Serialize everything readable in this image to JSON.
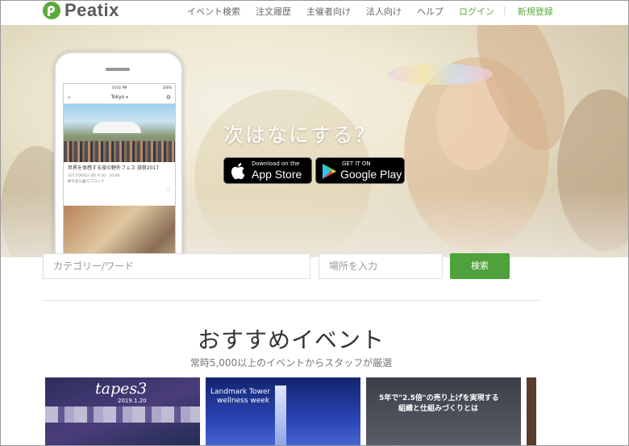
{
  "header": {
    "logo_text": "Peatix",
    "nav": [
      "イベント検索",
      "注文履歴",
      "主催者向け",
      "法人向け",
      "ヘルプ"
    ],
    "login": "ログイン",
    "signup": "新規登録"
  },
  "hero": {
    "title": "次はなにする？",
    "appstore": {
      "small": "Download on the",
      "big": "App Store"
    },
    "googleplay": {
      "small": "GET IT ON",
      "big": "Google Play"
    }
  },
  "phone": {
    "status_time": "10:02 PM",
    "status_battery": "100%",
    "location": "Tokyo",
    "event_title": "世界を体感する旅の野外フェス 旅祭2017",
    "event_date": "2017/09/03 (日) 9:30 - 20:00",
    "event_place": "夢の島公園 Gブロック"
  },
  "search": {
    "category_placeholder": "カテゴリー/ワード",
    "location_placeholder": "場所を入力",
    "button": "検索"
  },
  "featured": {
    "title": "おすすめイベント",
    "subtitle": "常時5,000以上のイベントからスタッフが厳選",
    "cards": [
      {
        "title": "tapes3",
        "sub": "2019.1.20"
      },
      {
        "title": "Landmark Tower",
        "title2": "wellness week"
      },
      {
        "title": "5年で\"2.5倍\"の売り上げを実現する",
        "title2": "組織と仕組みづくりとは"
      }
    ]
  },
  "colors": {
    "brand_green": "#5aaa3c",
    "button_green": "#4ea13b"
  }
}
